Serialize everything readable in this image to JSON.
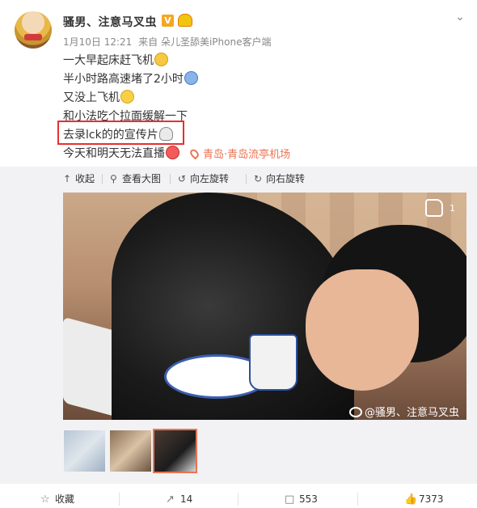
{
  "user": {
    "name": "骚男、注意马叉虫",
    "verified_badge": "V"
  },
  "meta": {
    "date": "1月10日 12:21",
    "source": "来自 朵儿圣舔美iPhone客户端"
  },
  "post": {
    "lines": [
      "一大早起床赶飞机",
      "半小时路高速堵了2小时",
      "又没上飞机",
      "和小法吃个拉面缓解一下",
      "去录lck的的宣传片",
      "今天和明天无法直播"
    ],
    "emoji_icons": [
      "cat-face-icon",
      "screaming-face-icon",
      "sweat-smile-icon",
      "ghost-icon",
      "heart-eyes-icon"
    ]
  },
  "location": {
    "text": "青岛·青岛流亭机场"
  },
  "toolbar": {
    "collapse": "收起",
    "view_large": "查看大图",
    "rotate_left": "向左旋转",
    "rotate_right": "向右旋转"
  },
  "photo": {
    "like_count": "1",
    "watermark": "@骚男、注意马叉虫"
  },
  "actions": {
    "favorite": "收藏",
    "repost_count": "14",
    "comment_count": "553",
    "like_count": "7373"
  },
  "colors": {
    "accent": "#eb7350",
    "highlight": "#e53030",
    "panel_bg": "#f2f2f5"
  }
}
